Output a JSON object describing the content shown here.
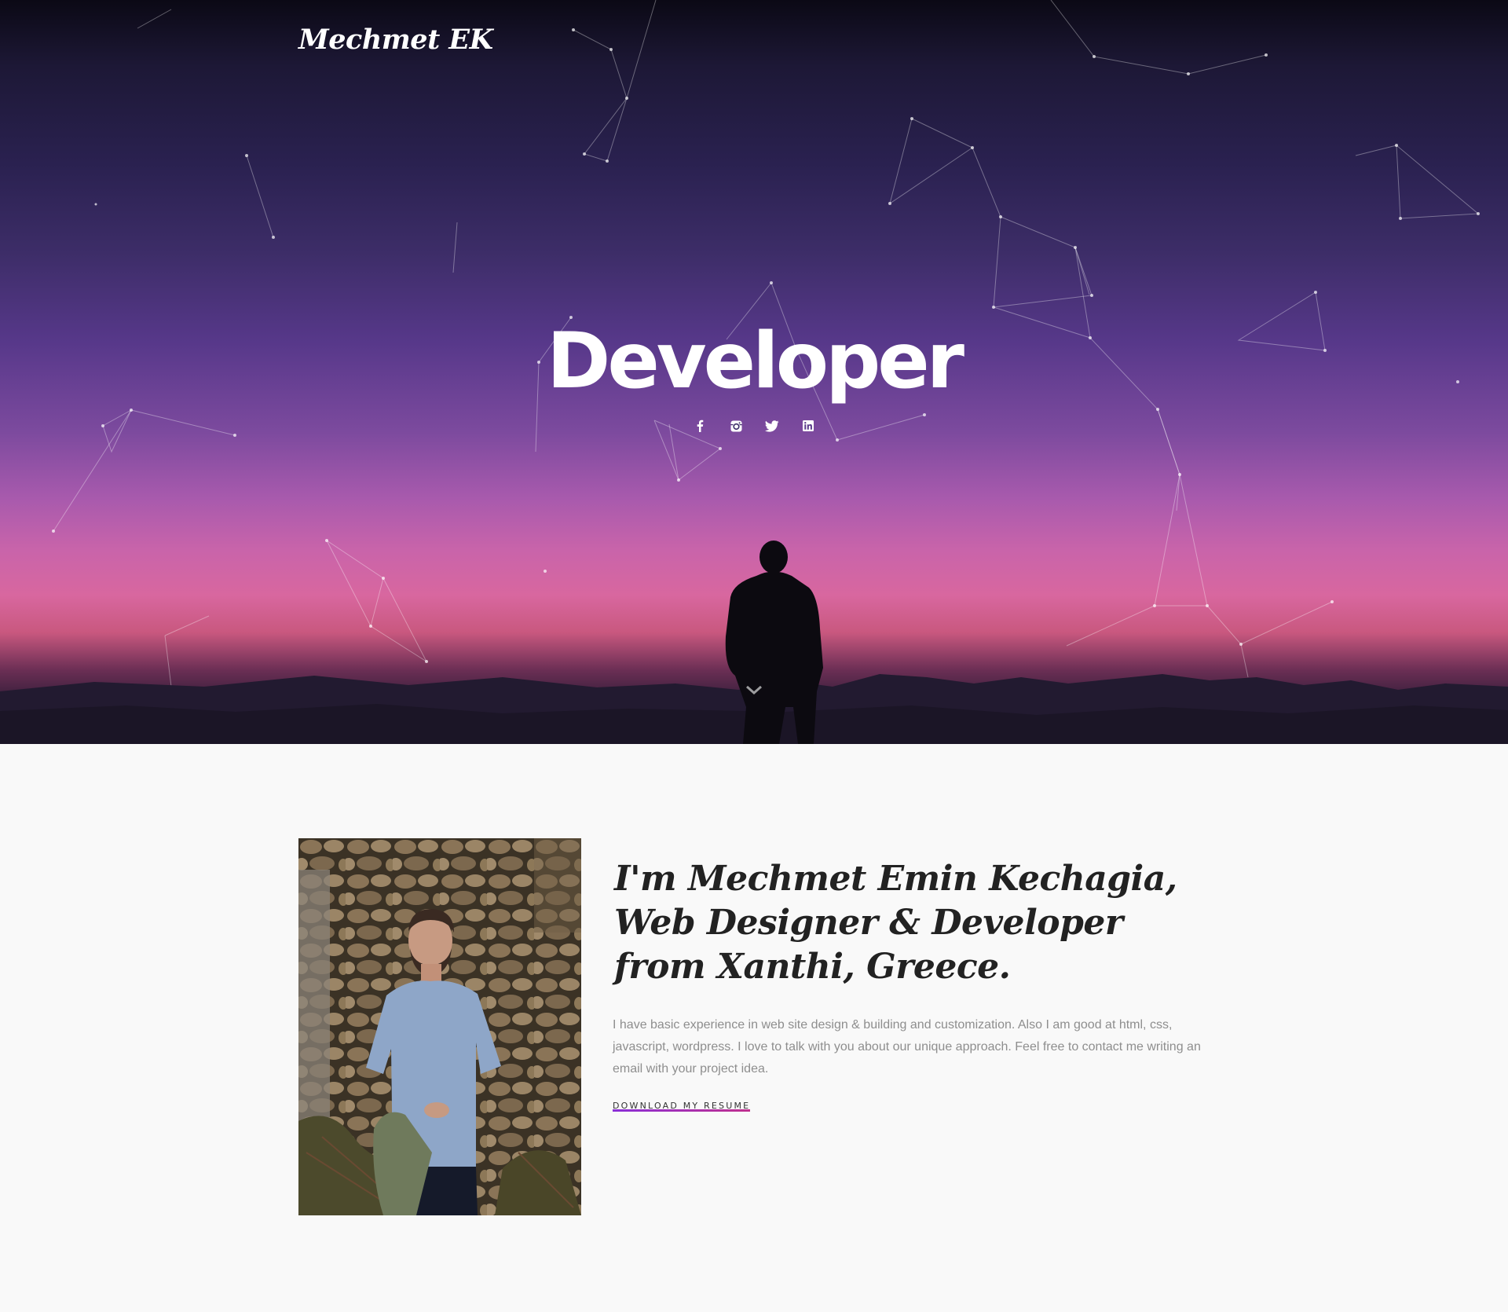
{
  "brand": {
    "logo": "Mechmet EK"
  },
  "hero": {
    "title": "Developer",
    "socials": [
      "facebook-icon",
      "instagram-icon",
      "twitter-icon",
      "linkedin-icon"
    ],
    "scroll_icon": "chevron-down-icon"
  },
  "about": {
    "heading_lines": [
      "I'm Mechmet Emin Kechagia,",
      "Web Designer & Developer",
      "from Xanthi, Greece."
    ],
    "bio": "I have basic experience in web site design & building and customization. Also I am good at html, css, javascript, wordpress. I love to talk with you about our unique approach. Feel free to contact me writing an email with your project idea.",
    "resume_label": "DOWNLOAD MY RESUME"
  },
  "colors": {
    "accent_start": "#8a2fd8",
    "accent_end": "#c0308e",
    "heading": "#222222",
    "body_text": "#8e8e8e",
    "section_bg": "#f9f9f9"
  }
}
